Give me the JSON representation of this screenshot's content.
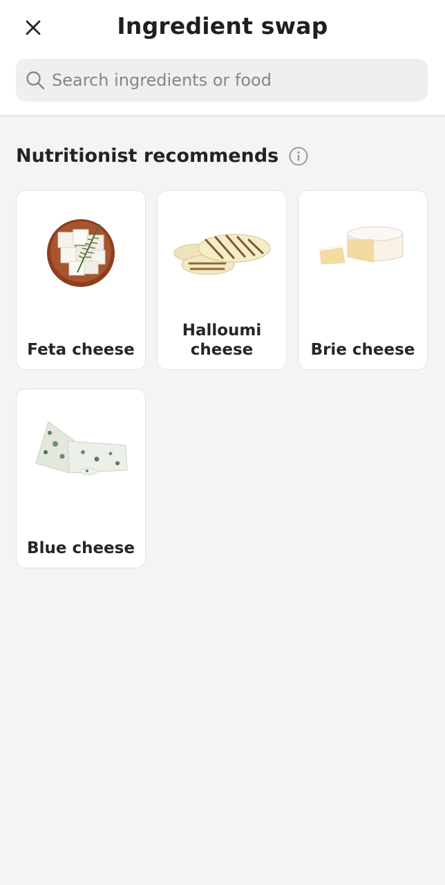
{
  "header": {
    "title": "Ingredient swap",
    "close_icon": "close-icon"
  },
  "search": {
    "placeholder": "Search ingredients or food",
    "value": "",
    "icon": "search-icon"
  },
  "section": {
    "title": "Nutritionist recommends",
    "info_icon": "info-icon"
  },
  "items": [
    {
      "label": "Feta cheese",
      "image": "feta-cheese-image"
    },
    {
      "label": "Halloumi cheese",
      "image": "halloumi-cheese-image"
    },
    {
      "label": "Brie cheese",
      "image": "brie-cheese-image"
    },
    {
      "label": "Blue cheese",
      "image": "blue-cheese-image"
    }
  ],
  "colors": {
    "background": "#f4f4f4",
    "card": "#ffffff",
    "search_bg": "#efefef",
    "text": "#222222",
    "placeholder": "#858585"
  }
}
